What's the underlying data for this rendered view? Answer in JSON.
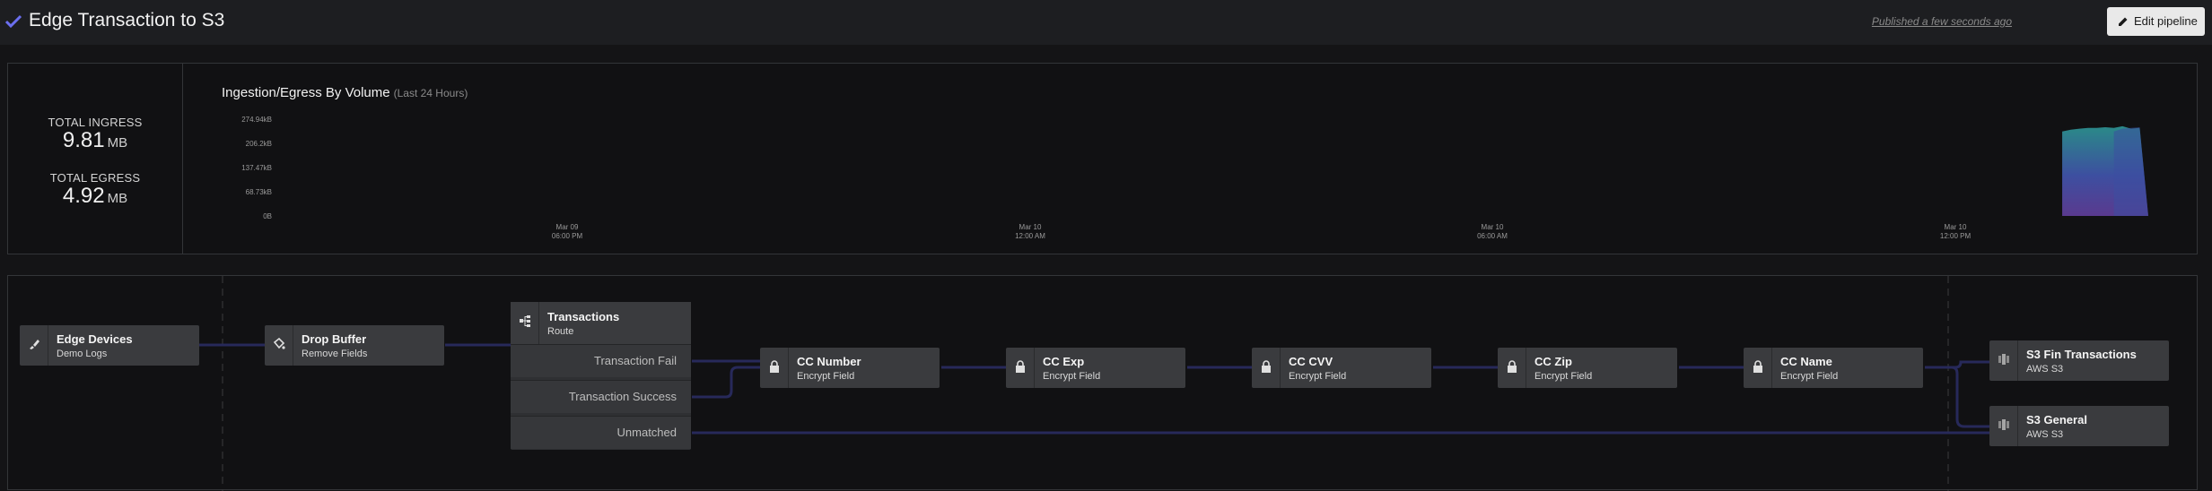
{
  "header": {
    "title": "Edge Transaction to S3",
    "published": "Published a few seconds ago",
    "edit_button": "Edit pipeline"
  },
  "stats": {
    "ingress_label": "TOTAL INGRESS",
    "ingress_value": "9.81",
    "ingress_unit": "MB",
    "egress_label": "TOTAL EGRESS",
    "egress_value": "4.92",
    "egress_unit": "MB"
  },
  "chart_data": {
    "type": "area",
    "title": "Ingestion/Egress By Volume",
    "subtitle": "(Last 24 Hours)",
    "y_ticks": [
      "274.94kB",
      "206.2kB",
      "137.47kB",
      "68.73kB",
      "0B"
    ],
    "ylim": [
      0,
      274.94
    ],
    "x_ticks": [
      {
        "date": "Mar 09",
        "time": "06:00 PM"
      },
      {
        "date": "Mar 10",
        "time": "12:00 AM"
      },
      {
        "date": "Mar 10",
        "time": "06:00 AM"
      },
      {
        "date": "Mar 10",
        "time": "12:00 PM"
      }
    ],
    "series": [
      {
        "values": [
          0,
          0,
          0,
          0,
          0,
          0,
          0,
          0,
          0,
          0,
          0,
          0,
          0,
          0,
          0,
          0,
          0,
          0,
          0,
          0,
          0,
          0,
          240,
          245,
          248,
          250,
          250,
          252,
          250,
          255,
          248,
          250,
          0
        ]
      },
      {
        "values": [
          0,
          0,
          0,
          0,
          0,
          0,
          0,
          0,
          0,
          0,
          0,
          0,
          0,
          0,
          0,
          0,
          0,
          0,
          0,
          0,
          0,
          0,
          0,
          0,
          0,
          0,
          0,
          0,
          240,
          248,
          250,
          252,
          0
        ]
      }
    ],
    "colors": [
      "#2a8a88",
      "#3d4fa0",
      "#5a3a8f"
    ]
  },
  "pipeline": {
    "nodes": [
      {
        "title": "Edge Devices",
        "subtitle": "Demo Logs",
        "icon": "brush-icon"
      },
      {
        "title": "Drop Buffer",
        "subtitle": "Remove Fields",
        "icon": "bucket-icon"
      },
      {
        "title": "CC Number",
        "subtitle": "Encrypt Field",
        "icon": "lock-icon"
      },
      {
        "title": "CC Exp",
        "subtitle": "Encrypt Field",
        "icon": "lock-icon"
      },
      {
        "title": "CC CVV",
        "subtitle": "Encrypt Field",
        "icon": "lock-icon"
      },
      {
        "title": "CC Zip",
        "subtitle": "Encrypt Field",
        "icon": "lock-icon"
      },
      {
        "title": "CC Name",
        "subtitle": "Encrypt Field",
        "icon": "lock-icon"
      },
      {
        "title": "S3 Fin Transactions",
        "subtitle": "AWS S3",
        "icon": "s3-icon"
      },
      {
        "title": "S3 General",
        "subtitle": "AWS S3",
        "icon": "s3-icon"
      }
    ],
    "route": {
      "title": "Transactions",
      "subtitle": "Route",
      "icon": "route-icon",
      "outputs": [
        "Transaction Fail",
        "Transaction Success",
        "Unmatched"
      ]
    }
  }
}
